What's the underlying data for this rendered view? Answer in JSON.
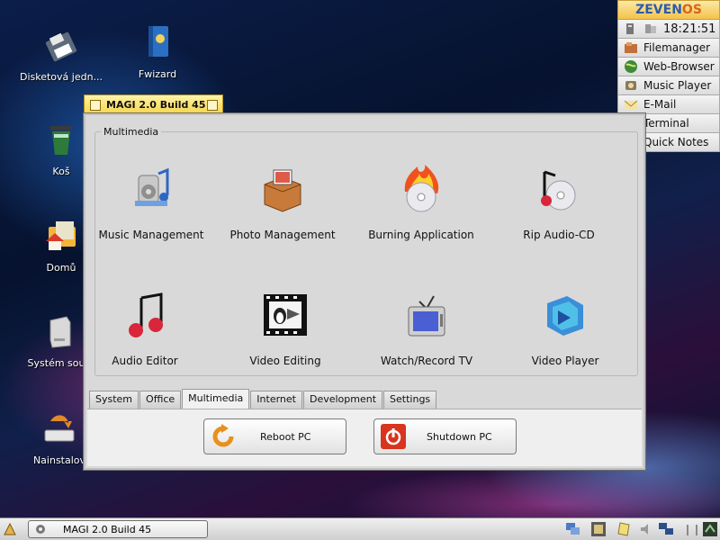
{
  "desktop": {
    "icons": [
      {
        "label": "Disketová jedn...",
        "icon": "floppy-icon"
      },
      {
        "label": "Fwizard",
        "icon": "book-icon"
      },
      {
        "label": "Koš",
        "icon": "trash-icon"
      },
      {
        "label": "Domů",
        "icon": "home-folder-icon"
      },
      {
        "label": "Systém soub",
        "icon": "drive-icon"
      },
      {
        "label": "Nainstalov",
        "icon": "install-icon"
      }
    ]
  },
  "launcher": {
    "brand_left": "ZEVEN",
    "brand_right": "OS",
    "clock": "18:21:51",
    "items": [
      {
        "label": "Filemanager",
        "icon": "filemanager-icon"
      },
      {
        "label": "Web-Browser",
        "icon": "globe-icon"
      },
      {
        "label": "Music Player",
        "icon": "music-icon"
      },
      {
        "label": "E-Mail",
        "icon": "mail-icon"
      },
      {
        "label": "Terminal",
        "icon": "terminal-icon"
      },
      {
        "label": "Quick Notes",
        "icon": "notes-icon"
      }
    ]
  },
  "window": {
    "title": "MAGI 2.0 Build 45",
    "group_title": "Multimedia",
    "apps": [
      {
        "label": "Music Management",
        "icon": "speaker-music-icon"
      },
      {
        "label": "Photo Management",
        "icon": "photo-box-icon"
      },
      {
        "label": "Burning Application",
        "icon": "burning-cd-icon"
      },
      {
        "label": "Rip Audio-CD",
        "icon": "rip-cd-icon"
      },
      {
        "label": "Audio Editor",
        "icon": "music-notes-icon"
      },
      {
        "label": "Video Editing",
        "icon": "film-strip-icon"
      },
      {
        "label": "Watch/Record TV",
        "icon": "tv-icon"
      },
      {
        "label": "Video Player",
        "icon": "video-player-icon"
      }
    ],
    "tabs": [
      "System",
      "Office",
      "Multimedia",
      "Internet",
      "Development",
      "Settings"
    ],
    "active_tab": "Multimedia",
    "reboot_label": "Reboot PC",
    "shutdown_label": "Shutdown PC"
  },
  "taskbar": {
    "task_label": "MAGI 2.0 Build 45"
  },
  "colors": {
    "title_yellow": "#f5d547",
    "window_bg": "#d9d9d9",
    "brand_blue": "#2a5ca8",
    "brand_orange": "#d8641a"
  }
}
